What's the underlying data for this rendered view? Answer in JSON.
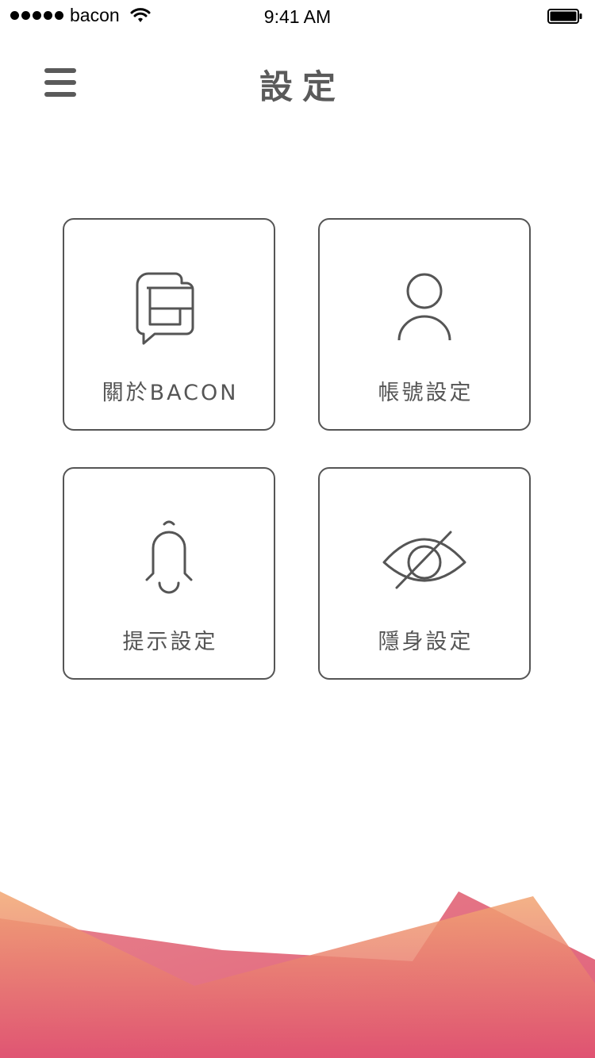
{
  "status_bar": {
    "carrier": "bacon",
    "time": "9:41 AM"
  },
  "header": {
    "title": "設定"
  },
  "tiles": [
    {
      "label": "關於BACON",
      "icon": "bacon-chat-icon"
    },
    {
      "label": "帳號設定",
      "icon": "user-icon"
    },
    {
      "label": "提示設定",
      "icon": "bell-icon"
    },
    {
      "label": "隱身設定",
      "icon": "eye-slash-icon"
    }
  ],
  "colors": {
    "text": "#555555",
    "gradient_orange": "#F0A06A",
    "gradient_pink": "#DE4F6E"
  }
}
